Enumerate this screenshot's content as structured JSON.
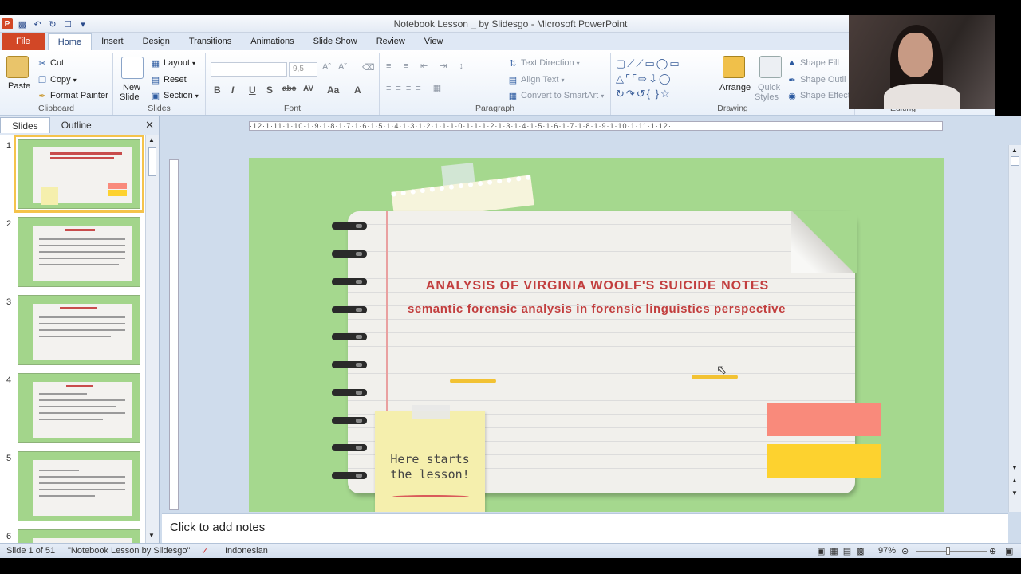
{
  "window": {
    "title": "Notebook Lesson _ by Slidesgo  -  Microsoft PowerPoint"
  },
  "qat": {
    "app_icon": "P"
  },
  "tabs": [
    "File",
    "Home",
    "Insert",
    "Design",
    "Transitions",
    "Animations",
    "Slide Show",
    "Review",
    "View"
  ],
  "ribbon": {
    "clipboard": {
      "label": "Clipboard",
      "paste": "Paste",
      "cut": "Cut",
      "copy": "Copy",
      "format_painter": "Format Painter"
    },
    "slides": {
      "label": "Slides",
      "new_slide": "New",
      "new_slide2": "Slide",
      "layout": "Layout",
      "reset": "Reset",
      "section": "Section"
    },
    "font": {
      "label": "Font",
      "size": "9,5"
    },
    "paragraph": {
      "label": "Paragraph",
      "text_direction": "Text Direction",
      "align_text": "Align Text",
      "convert": "Convert to SmartArt"
    },
    "drawing": {
      "label": "Drawing",
      "arrange": "Arrange",
      "quick_styles": "Quick",
      "quick_styles2": "Styles",
      "shape_fill": "Shape Fill",
      "shape_outline": "Shape Outli",
      "shape_effects": "Shape Effect"
    },
    "editing": {
      "label": "Editing"
    }
  },
  "panel": {
    "tabs": [
      "Slides",
      "Outline"
    ]
  },
  "thumbnails": [
    {
      "num": "1",
      "selected": true
    },
    {
      "num": "2",
      "selected": false
    },
    {
      "num": "3",
      "selected": false
    },
    {
      "num": "4",
      "selected": false
    },
    {
      "num": "5",
      "selected": false
    },
    {
      "num": "6",
      "selected": false
    }
  ],
  "ruler": {
    "h": "·12·1·11·1·10·1·9·1·8·1·7·1·6·1·5·1·4·1·3·1·2·1·1·1·0·1·1·1·2·1·3·1·4·1·5·1·6·1·7·1·8·1·9·1·10·1·11·1·12·"
  },
  "slide": {
    "title": "ANALYSIS OF VIRGINIA WOOLF'S SUICIDE NOTES",
    "subtitle": "semantic forensic analysis  in forensic linguistics perspective",
    "note_line1": "Here starts",
    "note_line2": "the lesson!",
    "colors": {
      "bg": "#a5d88e",
      "title": "#c23e3e",
      "swatch1": "#f98a7b",
      "swatch2": "#fdd22f",
      "dash": "#f2c233"
    }
  },
  "notes": {
    "placeholder": "Click to add notes"
  },
  "status": {
    "slide": "Slide 1 of 51",
    "theme": "\"Notebook Lesson by Slidesgo\"",
    "language": "Indonesian",
    "zoom": "97%"
  }
}
